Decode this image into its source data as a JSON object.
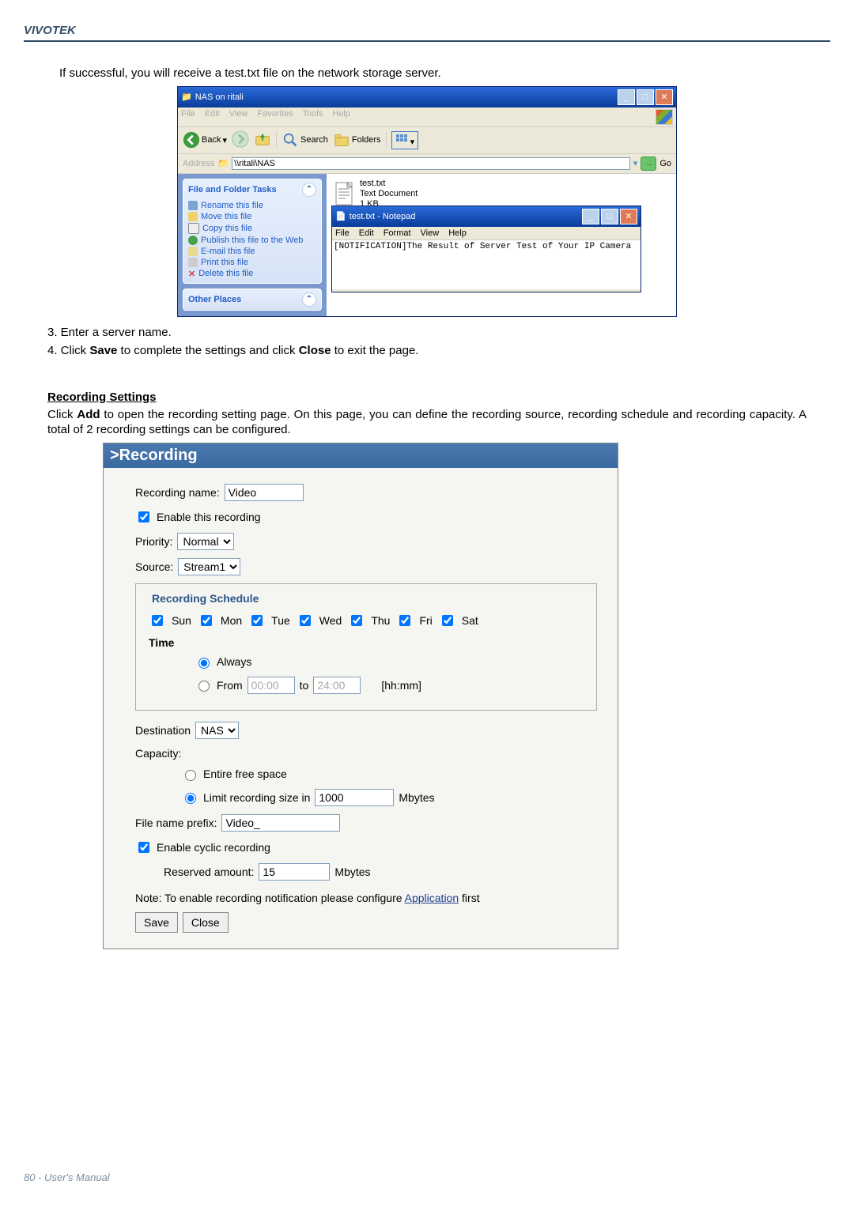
{
  "header": "VIVOTEK",
  "intro": "If successful, you will receive a test.txt file on the network storage server.",
  "explorer": {
    "title": "NAS on ritali",
    "menu": [
      "File",
      "Edit",
      "View",
      "Favorites",
      "Tools",
      "Help"
    ],
    "back_label": "Back",
    "search_label": "Search",
    "folders_label": "Folders",
    "address_label": "Address",
    "address_value": "\\\\ritali\\NAS",
    "go_label": "Go",
    "tasks_title": "File and Folder Tasks",
    "tasks": [
      "Rename this file",
      "Move this file",
      "Copy this file",
      "Publish this file to the Web",
      "E-mail this file",
      "Print this file",
      "Delete this file"
    ],
    "other_title": "Other Places",
    "file": {
      "name": "test.txt",
      "type": "Text Document",
      "size": "1 KB"
    }
  },
  "notepad": {
    "title": "test.txt - Notepad",
    "menu": [
      "File",
      "Edit",
      "Format",
      "View",
      "Help"
    ],
    "content": "[NOTIFICATION]The Result of Server Test of Your IP Camera"
  },
  "steps": {
    "s3": "3. Enter a server name.",
    "s4_a": "4. Click ",
    "s4_b": "Save",
    "s4_c": " to complete the settings and click ",
    "s4_d": "Close",
    "s4_e": " to exit the page."
  },
  "rec_title": "Recording Settings",
  "rec_intro": "Click Add to open the recording setting page. On this page, you can define the recording source, recording schedule and recording capacity. A total of 2 recording settings can be configured.",
  "recording": {
    "panel_title": ">Recording",
    "name_label": "Recording name:",
    "name_value": "Video",
    "enable_label": "Enable this recording",
    "priority_label": "Priority:",
    "priority_value": "Normal",
    "source_label": "Source:",
    "source_value": "Stream1",
    "schedule_title": "Recording Schedule",
    "days": [
      "Sun",
      "Mon",
      "Tue",
      "Wed",
      "Thu",
      "Fri",
      "Sat"
    ],
    "time_label": "Time",
    "always_label": "Always",
    "from_label": "From",
    "from_value": "00:00",
    "to_label": "to",
    "to_value": "24:00",
    "hhmm": "[hh:mm]",
    "dest_label": "Destination",
    "dest_value": "NAS",
    "capacity_label": "Capacity:",
    "cap_opt1": "Entire free space",
    "cap_opt2": "Limit recording size in",
    "cap_size": "1000",
    "mbytes": "Mbytes",
    "prefix_label": "File name prefix:",
    "prefix_value": "Video_",
    "cyclic_label": "Enable cyclic recording",
    "reserved_label": "Reserved amount:",
    "reserved_value": "15",
    "note_a": "Note: To enable recording notification please configure ",
    "note_link": "Application",
    "note_b": " first",
    "save": "Save",
    "close": "Close"
  },
  "footer": "80 - User's Manual"
}
